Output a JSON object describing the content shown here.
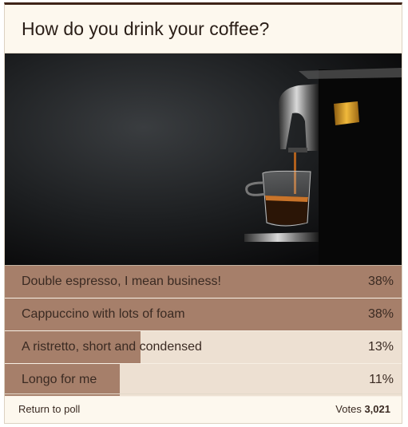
{
  "poll": {
    "title": "How do you drink your coffee?",
    "hero_image": "espresso-machine-photo",
    "options": [
      {
        "label": "Double espresso, I mean business!",
        "percent_text": "38%",
        "percent": 38
      },
      {
        "label": "Cappuccino with lots of foam",
        "percent_text": "38%",
        "percent": 38
      },
      {
        "label": "A ristretto, short and condensed",
        "percent_text": "13%",
        "percent": 13
      },
      {
        "label": "Longo for me",
        "percent_text": "11%",
        "percent": 11
      }
    ],
    "footer": {
      "return_label": "Return to poll",
      "votes_label": "Votes",
      "votes_count": "3,021"
    }
  },
  "colors": {
    "header_border": "#3f2417",
    "background": "#fdf8ee",
    "bar_fill": "#a67f6a",
    "bar_track": "#ede0d2"
  }
}
